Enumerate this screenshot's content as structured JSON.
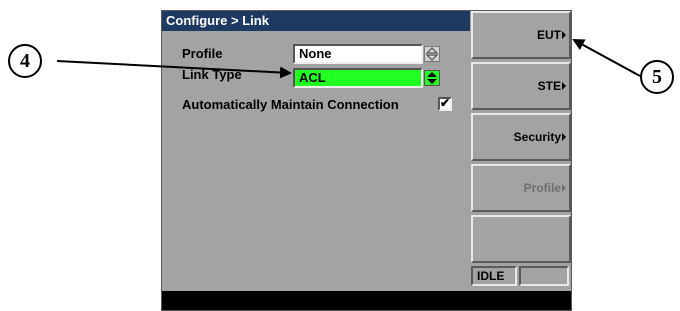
{
  "title": "Configure > Link",
  "form": {
    "profile_label": "Profile",
    "profile_value": "None",
    "link_type_label": "Link Type",
    "link_type_value": "ACL",
    "auto_maintain_label": "Automatically Maintain Connection",
    "auto_maintain_checked": true,
    "check_mark": "✔"
  },
  "softkeys": [
    {
      "label": "EUT",
      "enabled": true
    },
    {
      "label": "STE",
      "enabled": true
    },
    {
      "label": "Security",
      "enabled": true
    },
    {
      "label": "Profile",
      "enabled": false
    },
    {
      "label": "",
      "enabled": false
    }
  ],
  "status": {
    "state": "IDLE",
    "extra": ""
  },
  "callouts": [
    "4",
    "5"
  ],
  "colors": {
    "titlebar": "#1e3a63",
    "active_field": "#22ff22",
    "screen_bg": "#a3a3a3"
  }
}
